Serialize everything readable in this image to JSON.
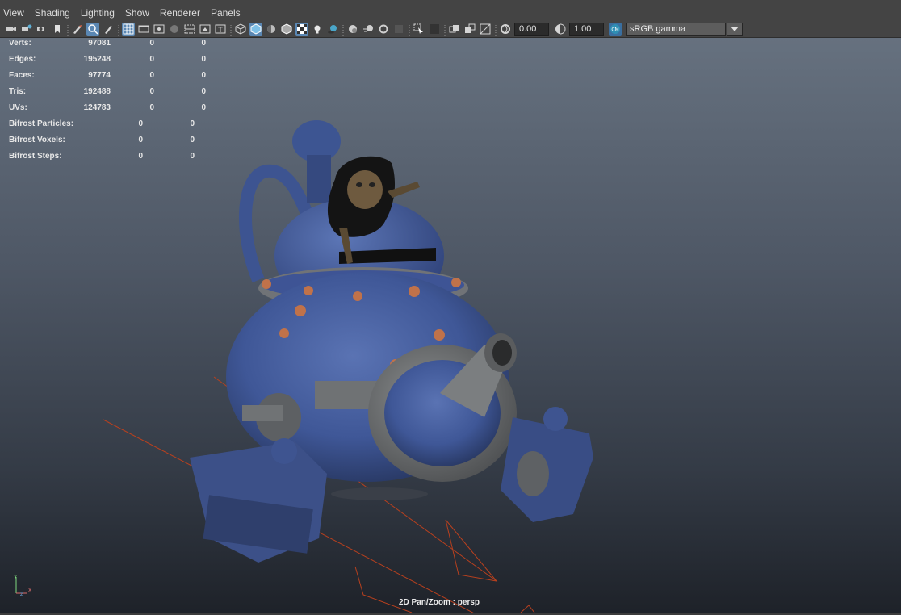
{
  "menu": [
    "View",
    "Shading",
    "Lighting",
    "Show",
    "Renderer",
    "Panels"
  ],
  "toolbar": {
    "exposure_value": "0.00",
    "gamma_value": "1.00",
    "color_space": "sRGB gamma"
  },
  "hud": [
    {
      "label": "Verts:",
      "v1": "97081",
      "v2": "0",
      "v3": "0"
    },
    {
      "label": "Edges:",
      "v1": "195248",
      "v2": "0",
      "v3": "0"
    },
    {
      "label": "Faces:",
      "v1": "97774",
      "v2": "0",
      "v3": "0"
    },
    {
      "label": "Tris:",
      "v1": "192488",
      "v2": "0",
      "v3": "0"
    },
    {
      "label": "UVs:",
      "v1": "124783",
      "v2": "0",
      "v3": "0"
    },
    {
      "label": "Bifrost Particles:",
      "v1": "",
      "v2": "0",
      "v3": "0"
    },
    {
      "label": "Bifrost Voxels:",
      "v1": "",
      "v2": "0",
      "v3": "0"
    },
    {
      "label": "Bifrost Steps:",
      "v1": "",
      "v2": "0",
      "v3": "0"
    }
  ],
  "axis": {
    "y": "y",
    "x": "x",
    "z": "z"
  },
  "camera_label": "2D Pan/Zoom : persp",
  "colors": {
    "accent": "#5a87b3",
    "menubar": "#444444",
    "rust_line": "#b8401e",
    "tank_blue": "#3f5a9a"
  }
}
